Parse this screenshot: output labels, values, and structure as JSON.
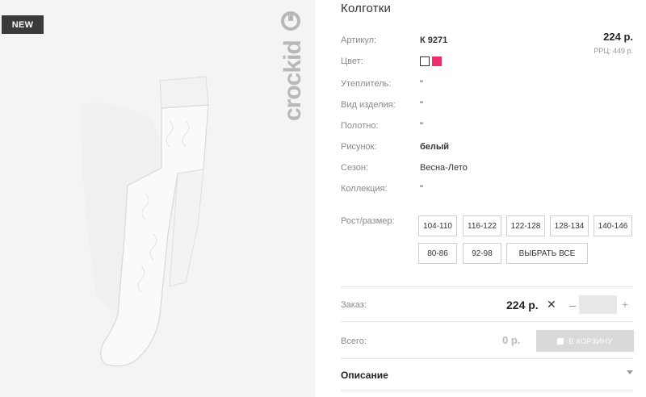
{
  "badge": "NEW",
  "brand": "crockid",
  "product": {
    "title": "Колготки"
  },
  "attributes": [
    {
      "label": "Артикул:",
      "value": "К 9271"
    },
    {
      "label": "Цвет:",
      "value": ""
    },
    {
      "label": "Утеплитель:",
      "value": "\""
    },
    {
      "label": "Вид изделия:",
      "value": "\""
    },
    {
      "label": "Полотно:",
      "value": "\""
    },
    {
      "label": "Рисунок:",
      "value": "белый"
    },
    {
      "label": "Сезон:",
      "value": "Весна-Лето"
    },
    {
      "label": "Коллекция:",
      "value": "\""
    },
    {
      "label": "Рост/размер:",
      "value": ""
    }
  ],
  "price": {
    "main": "224 р.",
    "rrp": "РРЦ: 449 р."
  },
  "colors": [
    "#ffffff",
    "#f0306e"
  ],
  "sizes": [
    "104-110",
    "116-122",
    "122-128",
    "128-134",
    "140-146",
    "80-86",
    "92-98"
  ],
  "select_all": "ВЫБРАТЬ ВСЕ",
  "order": {
    "label": "Заказ:",
    "price": "224 р.",
    "times": "✕",
    "minus": "–",
    "plus": "+",
    "qty": ""
  },
  "total": {
    "label": "Всего:",
    "value": "0 р.",
    "cart_label": "В КОРЗИНУ"
  },
  "description": {
    "title": "Описание"
  }
}
